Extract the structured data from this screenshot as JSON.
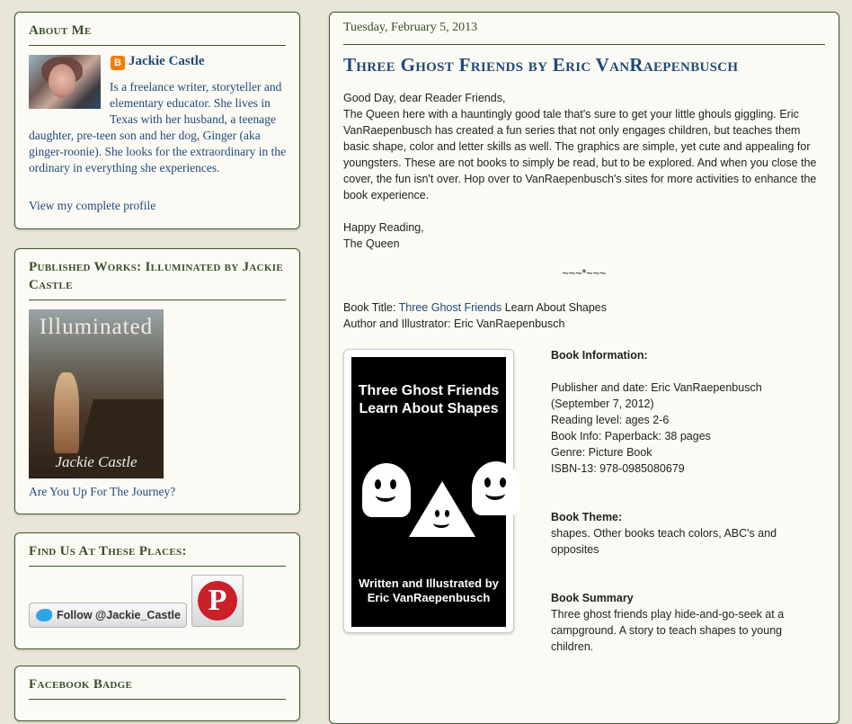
{
  "about": {
    "title": "About Me",
    "name": "Jackie Castle",
    "bio": "Is a freelance writer, storyteller and elementary educator. She lives in Texas with her husband, a teenage daughter, pre-teen son and her dog, Ginger (aka ginger-roonie). She looks for the extraordinary in the ordinary in everything she experiences.",
    "profile_link": "View my complete profile"
  },
  "published": {
    "title": "Published Works: Illuminated by Jackie Castle",
    "cover_title": "Illuminated",
    "cover_author": "Jackie Castle",
    "link": "Are You Up For The Journey?"
  },
  "findus": {
    "title": "Find Us At These Places:",
    "twitter_label": "Follow @Jackie_Castle",
    "pinterest_glyph": "P"
  },
  "facebook": {
    "title": "Facebook Badge"
  },
  "post": {
    "date": "Tuesday, February 5, 2013",
    "title": "Three Ghost Friends by Eric VanRaepenbusch",
    "greeting": "Good Day, dear Reader Friends,",
    "paragraph": "The Queen here with a hauntingly good tale that's sure to get your little ghouls giggling. Eric VanRaepenbusch has created a fun series that not only engages children, but teaches them basic shape, color and letter skills as well. The graphics are simple, yet cute and appealing for youngsters. These are not books to simply be read, but to be explored. And when you close the cover, the fun isn't over. Hop over to VanRaepenbusch's sites for more activities to enhance the book experience.",
    "signoff1": "Happy Reading,",
    "signoff2": "The Queen",
    "separator": "~~~*~~~",
    "book_title_label": "Book Title: ",
    "book_title_link": "Three Ghost Friends",
    "book_title_rest": " Learn About Shapes",
    "author_line": "Author and Illustrator: Eric VanRaepenbusch",
    "cover_top": "Three Ghost Friends Learn About Shapes",
    "cover_bottom": "Written and Illustrated by Eric VanRaepenbusch",
    "info_heading": "Book Information:",
    "publisher": "Publisher and date: Eric VanRaepenbusch (September 7, 2012)",
    "reading_level": "Reading level: ages 2-6",
    "book_info": "Book Info: Paperback: 38 pages",
    "genre": "Genre: Picture Book",
    "isbn": "ISBN-13: 978-0985080679",
    "theme_heading": "Book Theme:",
    "theme": "shapes. Other books teach colors, ABC's and opposites",
    "summary_heading": "Book Summary",
    "summary": "Three ghost friends play hide-and-go-seek at a campground. A story to teach shapes to young children."
  }
}
